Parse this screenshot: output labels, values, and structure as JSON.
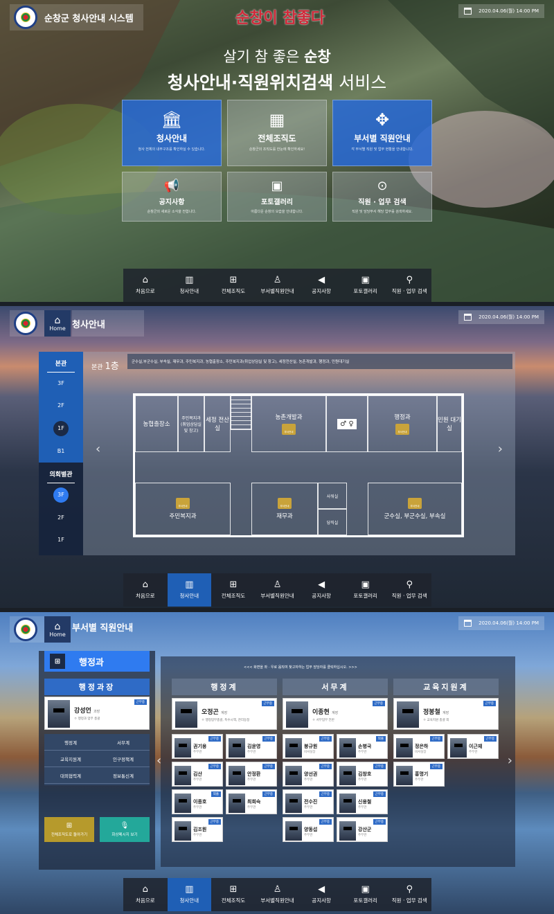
{
  "screen1": {
    "system_title": "순창군 청사안내 시스템",
    "brand_logo": "순창이 참좋다",
    "datetime": "2020.04.06(월) 14:00 PM",
    "hero_line1_pre": "살기 참 좋은 ",
    "hero_line1_bold": "순창",
    "hero_line2_bold": "청사안내·직원위치검색",
    "hero_line2_rest": " 서비스",
    "tiles": [
      {
        "icon": "building-icon",
        "title": "청사안내",
        "desc": "청사 전체의 내부구조를 확인하실 수 있습니다."
      },
      {
        "icon": "org-chart-icon",
        "title": "전체조직도",
        "desc": "순창군의 조직도를 한눈에 확인하세요!"
      },
      {
        "icon": "network-icon",
        "title": "부서별 직원안내",
        "desc": "각 부서별 직원 및 업무 현황을 안내합니다."
      },
      {
        "icon": "megaphone-icon",
        "title": "공지사항",
        "desc": "순창군의 새로운 소식을 전합니다."
      },
      {
        "icon": "photo-icon",
        "title": "포토갤러리",
        "desc": "아름다운 순창의 모습을 안내합니다."
      },
      {
        "icon": "search-icon",
        "title": "직원 · 업무 검색",
        "desc": "직원 및 담당부서 해당 업무를 검색하세요."
      }
    ]
  },
  "nav": [
    {
      "icon": "home-icon",
      "label": "처음으로"
    },
    {
      "icon": "building-icon",
      "label": "청사안내"
    },
    {
      "icon": "org-chart-icon",
      "label": "전체조직도"
    },
    {
      "icon": "people-tree-icon",
      "label": "부서별직원안내"
    },
    {
      "icon": "megaphone-icon",
      "label": "공지사항"
    },
    {
      "icon": "photo-icon",
      "label": "포토갤러리"
    },
    {
      "icon": "user-search-icon",
      "label": "직원 · 업무 검색"
    }
  ],
  "screen2": {
    "home_label": "Home",
    "page_title": "청사안내",
    "datetime": "2020.04.06(월) 14:00 PM",
    "main_building": "본관",
    "main_floors": [
      "3F",
      "2F",
      "1F",
      "B1"
    ],
    "annex_building": "의회별관",
    "annex_floors": [
      "3F",
      "2F",
      "1F"
    ],
    "floor_title_pre": "본관",
    "floor_title_big": "1층",
    "floor_desc": "군수실,부군수실, 부속실, 재무과, 주민복지과, 농협출장소, 주민복지과(취업상담실 및 창고), 세정전산실, 농촌개발과, 행정과, 민원대기실",
    "rooms": {
      "nonghyup": "농협출장소",
      "welfare_storage": "주민복지과 (취업상담실 및 창고)",
      "tax_it": "세정 전산실",
      "rural": "농촌개발과",
      "admin": "행정과",
      "civil_wait": "민원 대기실",
      "welfare": "주민복지과",
      "finance": "재무과",
      "duty_a": "사워실",
      "duty_b": "당직실",
      "mayor": "군수실, 부군수실, 부속실"
    },
    "badge_label": "부서안내"
  },
  "screen3": {
    "home_label": "Home",
    "page_title": "부서별 직원안내",
    "datetime": "2020.04.06(월) 14:00 PM",
    "dept": "행정과",
    "head_section": "행정과장",
    "head": {
      "name": "강성언",
      "rank": "과장",
      "desc": "ㅇ 행정과 업무 총괄",
      "status": "근무중"
    },
    "team_links": [
      "행정계",
      "서무계",
      "교육지원계",
      "인구정책계",
      "대외협력계",
      "정보통신계"
    ],
    "btn_org": "전체조직도로 돌아가기",
    "btn_msg": "화상메시지 보기",
    "notice": "<<< 화면을 좌 · 우로 움직여 찾고자하는 업무 담당자를 클릭하십시오. >>>",
    "teams": [
      {
        "name": "행정계",
        "lead": {
          "name": "오정곤",
          "rank": "계장",
          "desc": "ㅇ 행정업무총괄, 특수시책, 관리동정",
          "status": "근무중"
        },
        "members": [
          {
            "name": "권기용",
            "rank": "주무관",
            "status": "근무중"
          },
          {
            "name": "김윤영",
            "rank": "주무관",
            "status": "근무중"
          },
          {
            "name": "김산",
            "rank": "주무관",
            "status": "근무중"
          },
          {
            "name": "안정환",
            "rank": "주무관",
            "status": "근무중"
          },
          {
            "name": "이종호",
            "rank": "주무관",
            "status": "외출"
          },
          {
            "name": "최희숙",
            "rank": "주무관",
            "status": "근무중"
          },
          {
            "name": "김조원",
            "rank": "주무관",
            "status": "근무중"
          }
        ]
      },
      {
        "name": "서무계",
        "lead": {
          "name": "이종현",
          "rank": "계장",
          "desc": "ㅇ 서무업무 전반",
          "status": "근무중"
        },
        "members": [
          {
            "name": "봉규원",
            "rank": "비서실장",
            "status": "근무중"
          },
          {
            "name": "손병국",
            "rank": "주무관",
            "status": "외출"
          },
          {
            "name": "양선권",
            "rank": "주무관",
            "status": "근무중"
          },
          {
            "name": "김창호",
            "rank": "주무관",
            "status": "근무중"
          },
          {
            "name": "전수진",
            "rank": "주무관",
            "status": "근무중"
          },
          {
            "name": "신용철",
            "rank": "주무관",
            "status": "근무중"
          },
          {
            "name": "양동섭",
            "rank": "주무관",
            "status": "근무중"
          },
          {
            "name": "강산군",
            "rank": "주무관",
            "status": "근무중"
          }
        ]
      },
      {
        "name": "교육지원계",
        "lead": {
          "name": "정봉철",
          "rank": "계장",
          "desc": "ㅇ 교육지원 총괄 외",
          "status": "근무중"
        },
        "members": [
          {
            "name": "정은하",
            "rank": "비서실장",
            "status": "근무중"
          },
          {
            "name": "이근재",
            "rank": "주무관",
            "status": "근무중"
          },
          {
            "name": "홍명기",
            "rank": "주무관",
            "status": "근무중"
          }
        ]
      }
    ]
  }
}
